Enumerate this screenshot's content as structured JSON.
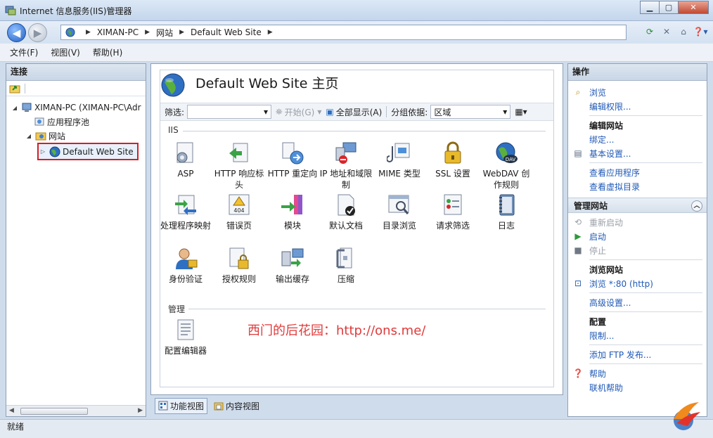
{
  "window": {
    "title": "Internet 信息服务(IIS)管理器"
  },
  "address": {
    "segments": [
      "XIMAN-PC",
      "网站",
      "Default Web Site"
    ]
  },
  "menu": [
    "文件(F)",
    "视图(V)",
    "帮助(H)"
  ],
  "left_panel": {
    "title": "连接",
    "tree": [
      {
        "label": "XIMAN-PC (XIMAN-PC\\Adr"
      },
      {
        "label": "应用程序池"
      },
      {
        "label": "网站"
      },
      {
        "label": "Default Web Site"
      }
    ]
  },
  "center": {
    "title": "Default Web Site 主页",
    "filter": {
      "label": "筛选:",
      "start": "开始(G)",
      "show_all": "全部显示(A)",
      "group_by": "分组依据:",
      "group_value": "区域"
    },
    "section_iis": "IIS",
    "section_manage": "管理",
    "features": [
      {
        "label": "ASP"
      },
      {
        "label": "HTTP 响应标头"
      },
      {
        "label": "HTTP 重定向"
      },
      {
        "label": "IP 地址和域限制"
      },
      {
        "label": "MIME 类型"
      },
      {
        "label": "SSL 设置"
      },
      {
        "label": "WebDAV 创作规则"
      },
      {
        "label": "处理程序映射"
      },
      {
        "label": "错误页"
      },
      {
        "label": "模块"
      },
      {
        "label": "默认文档"
      },
      {
        "label": "目录浏览"
      },
      {
        "label": "请求筛选"
      },
      {
        "label": "日志"
      },
      {
        "label": "身份验证"
      },
      {
        "label": "授权规则"
      },
      {
        "label": "输出缓存"
      },
      {
        "label": "压缩"
      }
    ],
    "manage_features": [
      {
        "label": "配置编辑器"
      }
    ],
    "watermark": "西门的后花园：http://ons.me/"
  },
  "view_tabs": [
    "功能视图",
    "内容视图"
  ],
  "actions": {
    "title": "操作",
    "top": [
      "浏览",
      "编辑权限..."
    ],
    "edit_site": {
      "title": "编辑网站",
      "items": [
        "绑定...",
        "基本设置...",
        "查看应用程序",
        "查看虚拟目录"
      ]
    },
    "manage_site": {
      "title": "管理网站",
      "items": [
        "重新启动",
        "启动",
        "停止"
      ]
    },
    "browse_site": {
      "title": "浏览网站",
      "items": [
        "浏览 *:80 (http)",
        "高级设置..."
      ]
    },
    "config": {
      "title": "配置",
      "items": [
        "限制..."
      ]
    },
    "ftp": "添加 FTP 发布...",
    "help": [
      "帮助",
      "联机帮助"
    ]
  },
  "status": {
    "text": "就绪"
  },
  "colors": {
    "link": "#1f59b7",
    "selection_border": "#d41f26",
    "watermark": "#e03a3a"
  }
}
